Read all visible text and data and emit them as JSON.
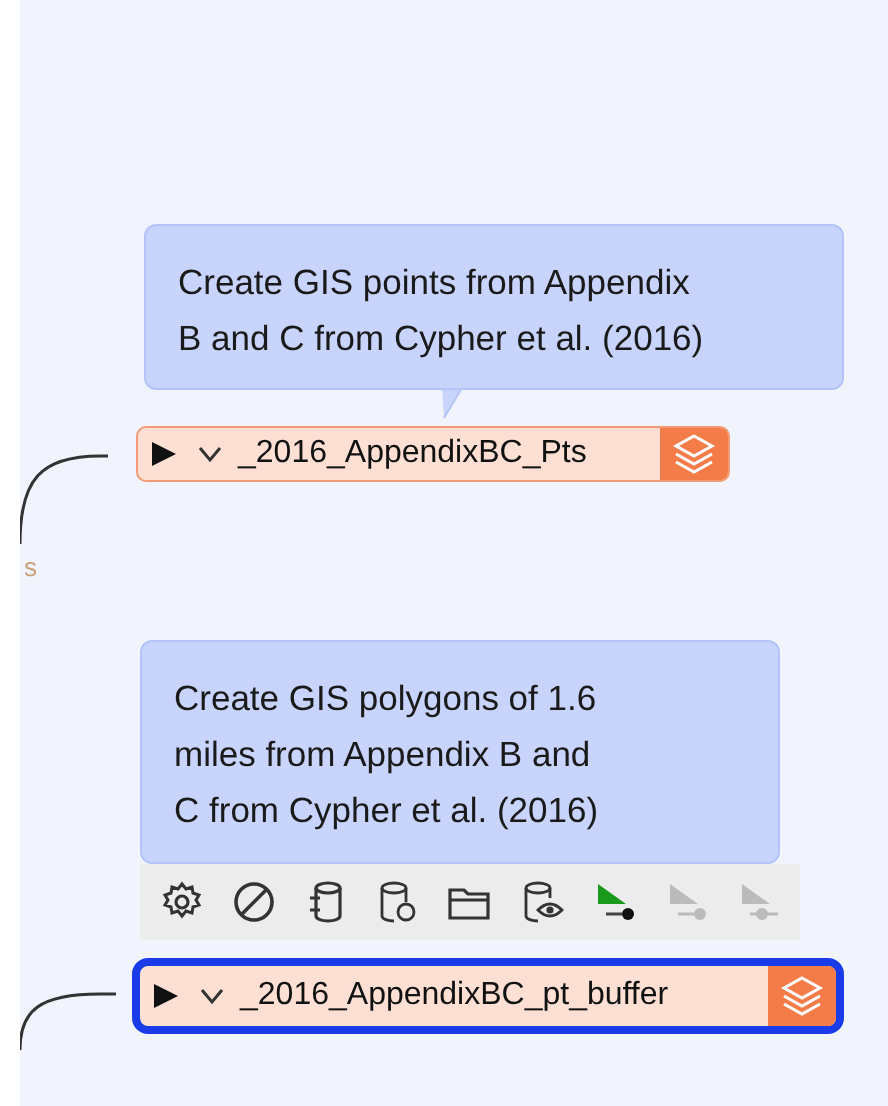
{
  "annotations": [
    {
      "lines": [
        "Create GIS points from Appendix",
        "B and C from Cypher et al. (2016)"
      ]
    },
    {
      "lines": [
        "Create GIS polygons of 1.6",
        "miles from Appendix B and",
        "C from Cypher et al. (2016)"
      ]
    }
  ],
  "nodes": [
    {
      "label": "_2016_AppendixBC_Pts",
      "selected": false
    },
    {
      "label": "_2016_AppendixBC_pt_buffer",
      "selected": true
    }
  ],
  "edge_label": "s",
  "toolbar": [
    {
      "kind": "gear",
      "disabled": false
    },
    {
      "kind": "disable",
      "disabled": false
    },
    {
      "kind": "source",
      "disabled": false
    },
    {
      "kind": "db-gear",
      "disabled": false
    },
    {
      "kind": "folder",
      "disabled": false
    },
    {
      "kind": "db-eye",
      "disabled": false
    },
    {
      "kind": "run",
      "disabled": false
    },
    {
      "kind": "run",
      "disabled": true
    },
    {
      "kind": "run-from",
      "disabled": true
    }
  ]
}
